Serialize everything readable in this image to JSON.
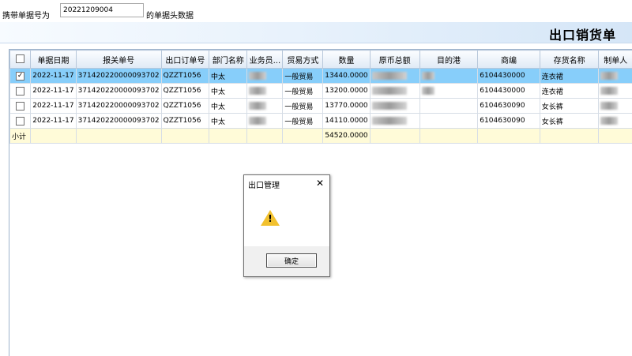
{
  "toolbar": {
    "label_before": "携带单据号为",
    "doc_no": "20221209004",
    "label_after": "的单据头数据"
  },
  "title": "出口销货单",
  "grid": {
    "columns": [
      "",
      "单据日期",
      "报关单号",
      "出口订单号",
      "部门名称",
      "业务员...",
      "贸易方式",
      "数量",
      "原币总额",
      "目的港",
      "商编",
      "存货名称",
      "制单人"
    ],
    "rows": [
      {
        "checked": true,
        "date": "2022-11-17",
        "customs_no": "371420220000093702",
        "order_no": "QZZT1056",
        "dept": "中太",
        "trade": "一般贸易",
        "qty": "13440.0000",
        "hs": "6104430000",
        "goods": "连衣裙"
      },
      {
        "checked": false,
        "date": "2022-11-17",
        "customs_no": "371420220000093702",
        "order_no": "QZZT1056",
        "dept": "中太",
        "trade": "一般贸易",
        "qty": "13200.0000",
        "hs": "6104430000",
        "goods": "连衣裙"
      },
      {
        "checked": false,
        "date": "2022-11-17",
        "customs_no": "371420220000093702",
        "order_no": "QZZT1056",
        "dept": "中太",
        "trade": "一般贸易",
        "qty": "13770.0000",
        "hs": "6104630090",
        "goods": "女长裤"
      },
      {
        "checked": false,
        "date": "2022-11-17",
        "customs_no": "371420220000093702",
        "order_no": "QZZT1056",
        "dept": "中太",
        "trade": "一般贸易",
        "qty": "14110.0000",
        "hs": "6104630090",
        "goods": "女长裤"
      }
    ],
    "summary": {
      "label": "小计",
      "qty": "54520.0000"
    },
    "selected_color": "#87cefa",
    "summary_color": "#fffbd8"
  },
  "dialog": {
    "title": "出口管理",
    "close": "✕",
    "icon": "warning-icon",
    "mark": "!",
    "ok": "确定"
  }
}
